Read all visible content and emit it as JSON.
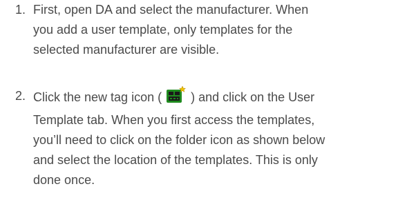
{
  "steps": [
    {
      "number": "1.",
      "lines": [
        "First, open DA and select the manufacturer. When",
        "you add a user template, only templates for the",
        "selected manufacturer are visible."
      ]
    },
    {
      "number": "2.",
      "line1_before_icon": "Click the new tag icon (",
      "line1_after_icon": ") and click on the User",
      "icon": "new-tag-icon",
      "lines": [
        "Template tab. When you first access the templates,",
        "you’ll need to click on the folder icon as shown below",
        "and select the location of the templates. This is only",
        "done once."
      ]
    }
  ],
  "colors": {
    "text": "#4a4a4a",
    "icon_green": "#1f8a1f",
    "icon_dark": "#1a1a1a",
    "icon_star": "#f2c200"
  }
}
